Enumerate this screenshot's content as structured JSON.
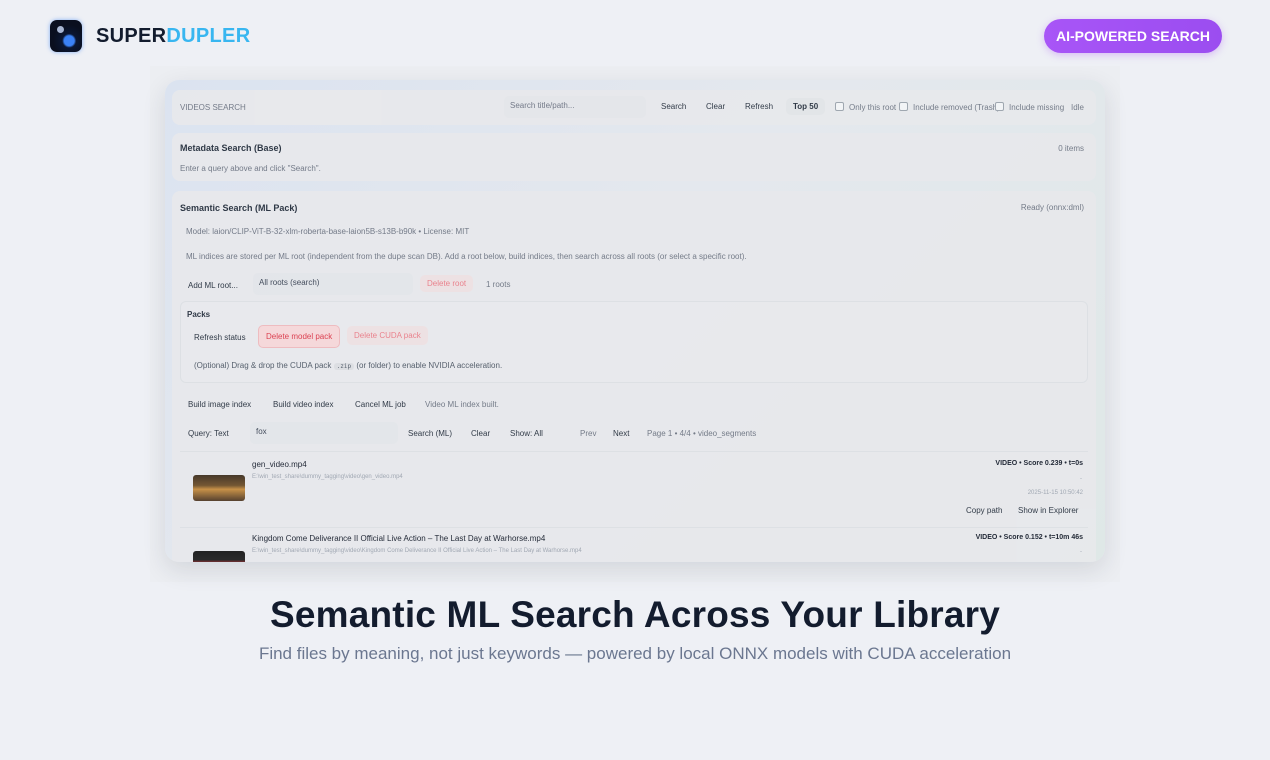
{
  "brand": {
    "part1": "SUPER",
    "part2": "DUPLER"
  },
  "badge": "AI-POWERED SEARCH",
  "app": {
    "toolbar": {
      "title": "VIDEOS SEARCH",
      "search_placeholder": "Search title/path...",
      "search_label": "Search",
      "clear_label": "Clear",
      "refresh_label": "Refresh",
      "top_label": "Top 50",
      "only_root_label": "Only this root",
      "include_removed_label": "Include removed (Trash)",
      "include_missing_label": "Include missing",
      "status": "Idle"
    },
    "metadata": {
      "title": "Metadata Search (Base)",
      "count": "0 items",
      "hint": "Enter a query above and click \"Search\"."
    },
    "semantic": {
      "title": "Semantic Search (ML Pack)",
      "status": "Ready (onnx:dml)",
      "model_line": "Model: laion/CLIP-ViT-B-32-xlm-roberta-base-laion5B-s13B-b90k • License: MIT",
      "info_line": "ML indices are stored per ML root (independent from the dupe scan DB). Add a root below, build indices, then search across all roots (or select a specific root).",
      "add_root_label": "Add ML root...",
      "roots_select": "All roots (search)",
      "delete_root_label": "Delete root",
      "roots_count": "1 roots",
      "packs": {
        "title": "Packs",
        "refresh_status_label": "Refresh status",
        "delete_model_label": "Delete model pack",
        "delete_cuda_label": "Delete CUDA pack",
        "drop_hint_pre": "(Optional) Drag & drop the CUDA pack",
        "drop_hint_code": ".zip",
        "drop_hint_post": "(or folder) to enable NVIDIA acceleration."
      },
      "build_image_label": "Build image index",
      "build_video_label": "Build video index",
      "cancel_label": "Cancel ML job",
      "build_status": "Video ML index built.",
      "query_mode": "Query: Text",
      "query_value": "fox",
      "search_ml_label": "Search (ML)",
      "clear_label": "Clear",
      "show_label": "Show: All",
      "prev_label": "Prev",
      "next_label": "Next",
      "page_info": "Page 1 • 4/4 • video_segments",
      "results": [
        {
          "name": "gen_video.mp4",
          "path": "E:\\win_test_share\\dummy_tagging\\video\\gen_video.mp4",
          "score": "VIDEO • Score 0.239 • t=0s",
          "dash": "-",
          "date": "2025-11-15 10:50:42",
          "copy_label": "Copy path",
          "explorer_label": "Show in Explorer"
        },
        {
          "name": "Kingdom Come Deliverance II Official Live Action – The Last Day at Warhorse.mp4",
          "path": "E:\\win_test_share\\dummy_tagging\\video\\Kingdom Come Deliverance II Official Live Action – The Last Day at Warhorse.mp4",
          "score": "VIDEO • Score 0.152 • t=10m 46s",
          "dash": "-"
        }
      ]
    }
  },
  "caption": {
    "headline": "Semantic ML Search Across Your Library",
    "subline": "Find files by meaning, not just keywords — powered by local ONNX models with CUDA acceleration"
  }
}
